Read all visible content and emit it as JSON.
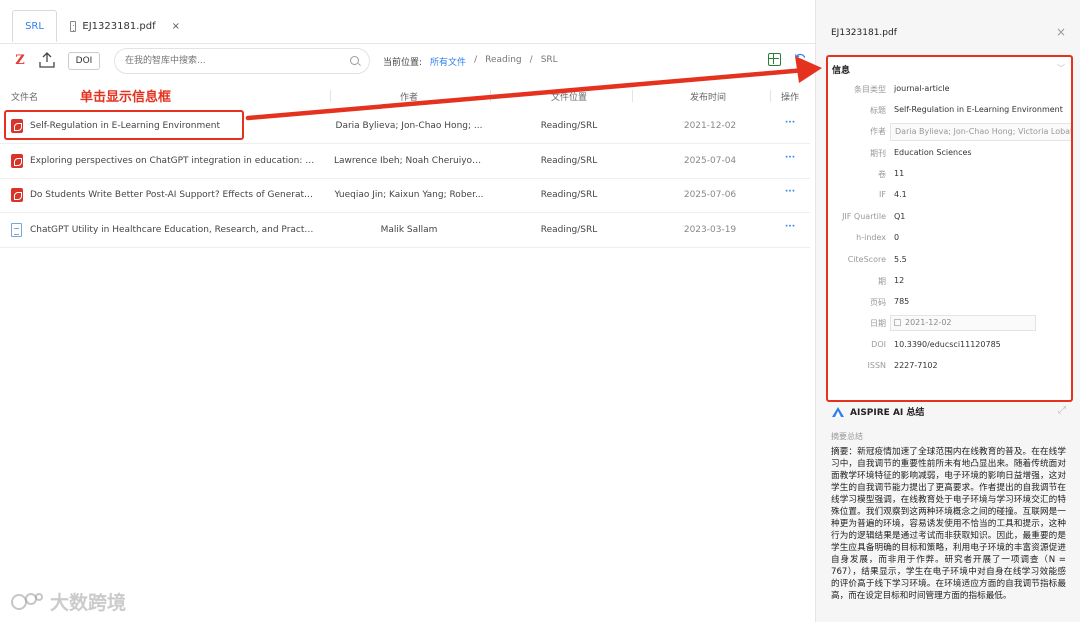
{
  "tabs": [
    {
      "label": "SRL",
      "active": true
    },
    {
      "label": "EJ1323181.pdf",
      "active": false
    }
  ],
  "tab_close_glyph": "×",
  "toolbar": {
    "logo": "Z",
    "doi_label": "DOI",
    "search_placeholder": "在我的智库中搜索...",
    "location_label": "当前位置:",
    "breadcrumb": [
      "所有文件",
      "/",
      "Reading",
      "/",
      "SRL"
    ]
  },
  "table": {
    "headers": [
      "文件名",
      "作者",
      "文件位置",
      "发布时间",
      "操作"
    ],
    "rows": [
      {
        "icon": "pdf-icon",
        "title": "Self-Regulation in E-Learning Environment",
        "author": "Daria Bylieva; Jon-Chao Hong; ...",
        "location": "Reading/SRL",
        "date": "2021-12-02",
        "more": "···"
      },
      {
        "icon": "pdf-icon",
        "title": "Exploring perspectives on ChatGPT integration in education: A s...",
        "author": "Lawrence Ibeh; Noah Cheruiyot ...",
        "location": "Reading/SRL",
        "date": "2025-07-04",
        "more": "···"
      },
      {
        "icon": "pdf-icon",
        "title": "Do Students Write Better Post-AI Support? Effects of Generative...",
        "author": "Yueqiao Jin; Kaixun Yang; Rober...",
        "location": "Reading/SRL",
        "date": "2025-07-06",
        "more": "···"
      },
      {
        "icon": "file-icon",
        "title": "ChatGPT Utility in Healthcare Education, Research, and Practice:...",
        "author": "Malik Sallam",
        "location": "Reading/SRL",
        "date": "2023-03-19",
        "more": "···"
      }
    ]
  },
  "annotation": "单击显示信息框",
  "panel": {
    "title": "EJ1323181.pdf",
    "close_glyph": "×",
    "info_heading": "信息",
    "fields": [
      {
        "key": "条目类型",
        "value": "journal-article"
      },
      {
        "key": "标题",
        "value": "Self-Regulation in E-Learning Environment"
      },
      {
        "key": "作者",
        "value": "Daria Bylieva; Jon-Chao Hong; Victoria Lobatyuk"
      },
      {
        "key": "期刊",
        "value": "Education Sciences"
      },
      {
        "key": "卷",
        "value": "11"
      },
      {
        "key": "IF",
        "value": "4.1"
      },
      {
        "key": "JIF Quartile",
        "value": "Q1"
      },
      {
        "key": "h-index",
        "value": "0"
      },
      {
        "key": "CiteScore",
        "value": "5.5"
      },
      {
        "key": "期",
        "value": "12"
      },
      {
        "key": "页码",
        "value": "785"
      },
      {
        "key": "日期",
        "value": "2021-12-02"
      },
      {
        "key": "DOI",
        "value": "10.3390/educsci11120785"
      },
      {
        "key": "ISSN",
        "value": "2227-7102"
      }
    ],
    "ai_title": "AISPIRE AI 总结",
    "abstract_label": "摘要总结",
    "abstract": "摘要：新冠疫情加速了全球范围内在线教育的普及。在在线学习中，自我调节的重要性前所未有地凸显出来。随着传统面对面教学环境特征的影响减弱，电子环境的影响日益增强，这对学生的自我调节能力提出了更高要求。作者提出的自我调节在线学习模型强调，在线教育处于电子环境与学习环境交汇的特殊位置。我们观察到这两种环境概念之间的碰撞。互联网是一种更为普遍的环境，容易诱发使用不恰当的工具和提示，这种行为的逻辑结果是通过考试而非获取知识。因此，最重要的是学生应具备明确的目标和策略，利用电子环境的丰富资源促进自身发展，而非用于作弊。研究者开展了一项调查（N = 767），结果显示，学生在电子环境中对自身在线学习效能感的评价高于线下学习环境。在环境适应方面的自我调节指标最高，而在设定目标和时间管理方面的指标最低。"
  },
  "watermark": "大数跨境",
  "colors": {
    "accent": "#2f80ed",
    "highlight": "#e5321f",
    "pdf": "#d9342b"
  }
}
